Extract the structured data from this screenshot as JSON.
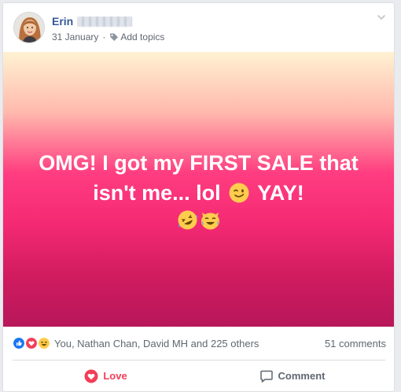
{
  "post": {
    "author_first_name": "Erin",
    "date": "31 January",
    "separator": "·",
    "add_topics": "Add topics",
    "text_line1": "OMG! I got my FIRST SALE that",
    "text_line2_a": "isn't me... lol",
    "text_line2_b": "YAY!",
    "background_colors": [
      "#fff2d2",
      "#ffb9ad",
      "#ff3d80",
      "#f52a74",
      "#d01b5f",
      "#b7175a"
    ]
  },
  "reactions": {
    "types": [
      "like-icon",
      "love-icon",
      "haha-icon"
    ],
    "summary": "You, Nathan Chan, David MH and 225 others",
    "comments": "51 comments"
  },
  "actions": {
    "love_label": "Love",
    "comment_label": "Comment"
  },
  "colors": {
    "name_link": "#385898",
    "love_active": "#f33e58",
    "secondary_text": "#606770"
  }
}
